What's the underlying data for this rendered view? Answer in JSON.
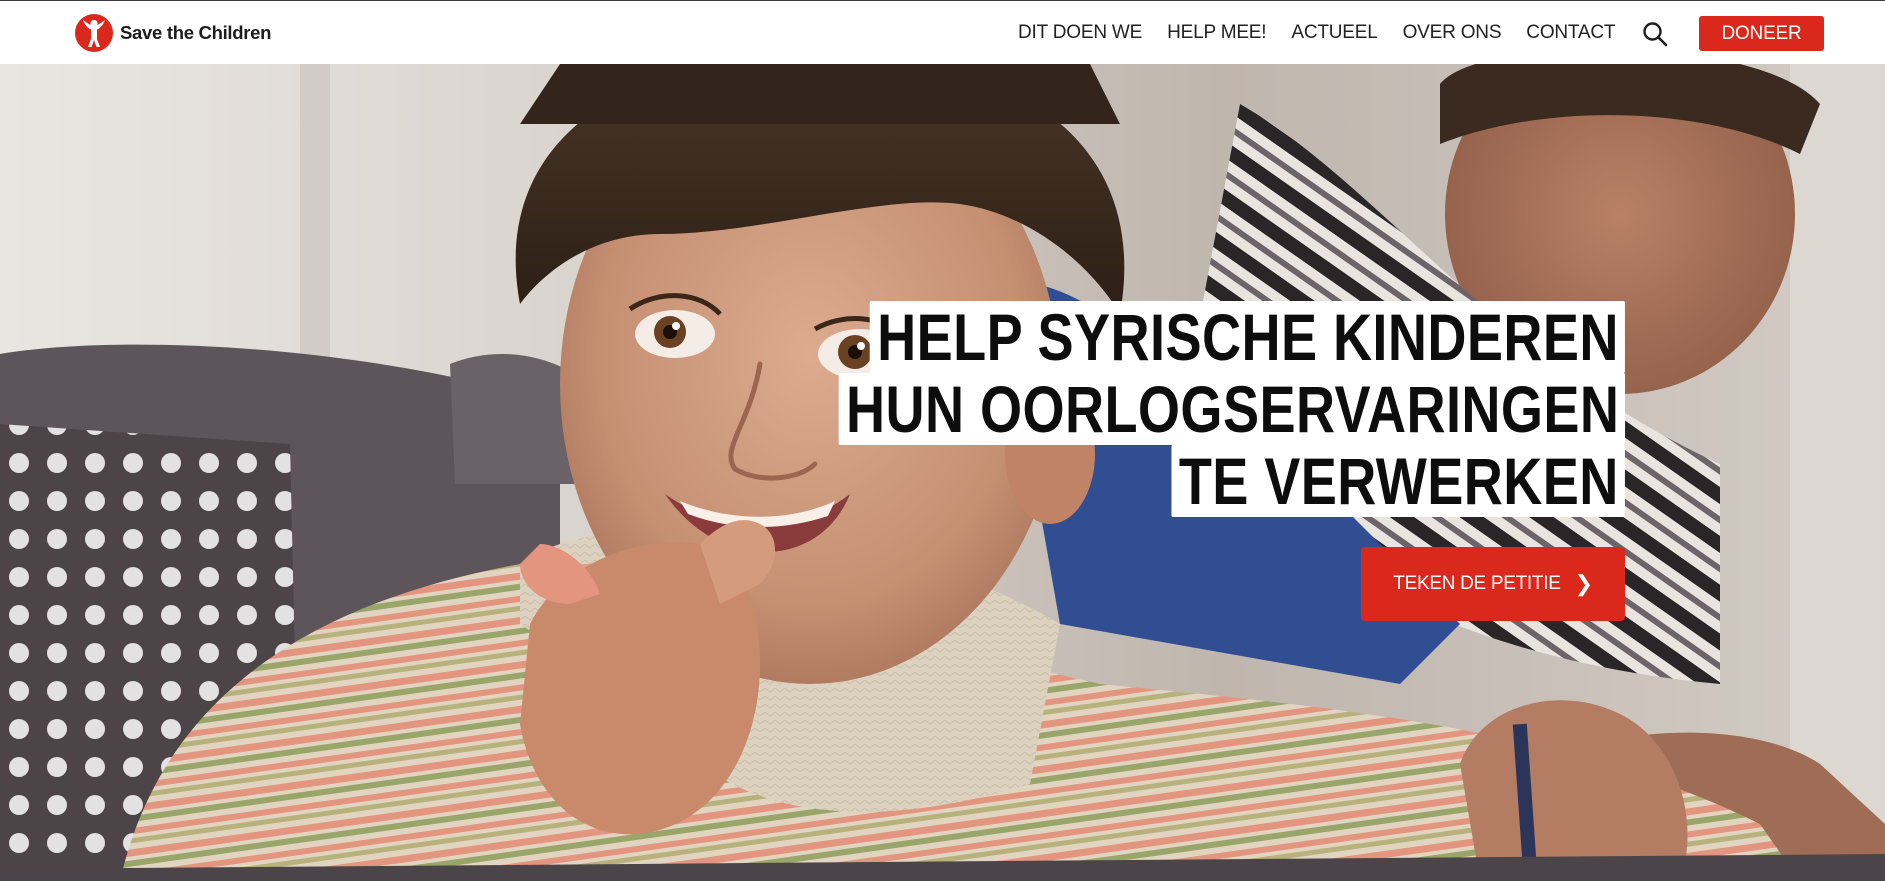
{
  "brand": {
    "name": "Save the Children",
    "logo_icon": "save-the-children-figure-icon",
    "accent_color": "#da291c"
  },
  "nav": {
    "items": [
      {
        "label": "DIT DOEN WE"
      },
      {
        "label": "HELP MEE!"
      },
      {
        "label": "ACTUEEL"
      },
      {
        "label": "OVER ONS"
      },
      {
        "label": "CONTACT"
      }
    ],
    "search_icon": "search-icon",
    "donate_label": "DONEER"
  },
  "hero": {
    "headline_lines": [
      "HELP SYRISCHE KINDEREN",
      "HUN OORLOGSERVARINGEN",
      "TE VERWERKEN"
    ],
    "cta_label": "TEKEN DE PETITIE",
    "cta_icon": "chevron-right-icon",
    "cta_chevron": "❯"
  }
}
